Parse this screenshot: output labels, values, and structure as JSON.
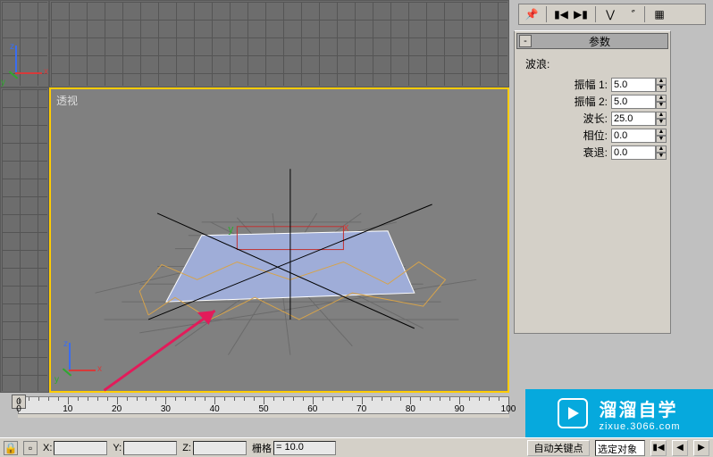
{
  "toolbar": {
    "icons": [
      "pin-icon",
      "separator",
      "prev-key-icon",
      "next-key-icon",
      "separator",
      "select-icon",
      "filter-icon",
      "separator",
      "config-icon"
    ]
  },
  "viewport": {
    "perspective_label": "透视",
    "axes": {
      "x": "x",
      "y": "y",
      "z": "z"
    }
  },
  "rollout": {
    "header_toggle": "-",
    "title": "参数",
    "group": "波浪:",
    "params": [
      {
        "label": "振幅 1:",
        "value": "5.0"
      },
      {
        "label": "振幅 2:",
        "value": "5.0"
      },
      {
        "label": "波长:",
        "value": "25.0"
      },
      {
        "label": "相位:",
        "value": "0.0"
      },
      {
        "label": "衰退:",
        "value": "0.0"
      }
    ]
  },
  "timeline": {
    "start": 0,
    "end": 100,
    "labels": [
      "0",
      "10",
      "20",
      "30",
      "40",
      "50",
      "60",
      "70",
      "80",
      "90",
      "100"
    ],
    "handle": "0"
  },
  "status": {
    "x_label": "X:",
    "x_value": "",
    "y_label": "Y:",
    "y_value": "",
    "z_label": "Z:",
    "z_value": "",
    "grid_label": "栅格",
    "grid_value": "= 10.0",
    "auto_key": "自动关键点",
    "selection_mode": "选定对象"
  },
  "watermark": {
    "title": "溜溜自学",
    "url": "zixue.3066.com"
  }
}
